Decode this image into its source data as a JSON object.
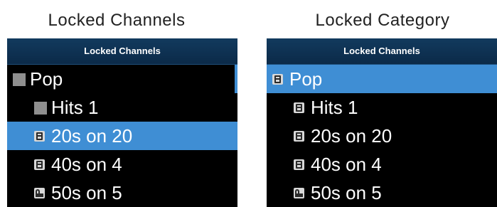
{
  "left_panel": {
    "caption": "Locked Channels",
    "header": "Locked Channels",
    "rows": [
      {
        "label": "Pop",
        "icon": "category-square-icon",
        "kind": "category",
        "selected": false
      },
      {
        "label": "Hits 1",
        "icon": "category-square-icon",
        "kind": "channel",
        "selected": false
      },
      {
        "label": "20s on 20",
        "icon": "lock-icon",
        "kind": "channel",
        "selected": true
      },
      {
        "label": "40s on 4",
        "icon": "lock-icon",
        "kind": "channel",
        "selected": false
      },
      {
        "label": "50s on 5",
        "icon": "unlock-icon",
        "kind": "channel",
        "selected": false
      }
    ]
  },
  "right_panel": {
    "caption": "Locked Category",
    "header": "Locked Channels",
    "rows": [
      {
        "label": "Pop",
        "icon": "lock-icon",
        "kind": "category",
        "selected": true
      },
      {
        "label": "Hits 1",
        "icon": "lock-icon",
        "kind": "channel",
        "selected": false
      },
      {
        "label": "20s on 20",
        "icon": "lock-icon",
        "kind": "channel",
        "selected": false
      },
      {
        "label": "40s on 4",
        "icon": "lock-icon",
        "kind": "channel",
        "selected": false
      },
      {
        "label": "50s on 5",
        "icon": "unlock-icon",
        "kind": "channel",
        "selected": false
      }
    ]
  },
  "colors": {
    "selection": "#3f8ed4",
    "header": "#0b2a48",
    "screen_bg": "#000000",
    "text": "#ffffff"
  }
}
